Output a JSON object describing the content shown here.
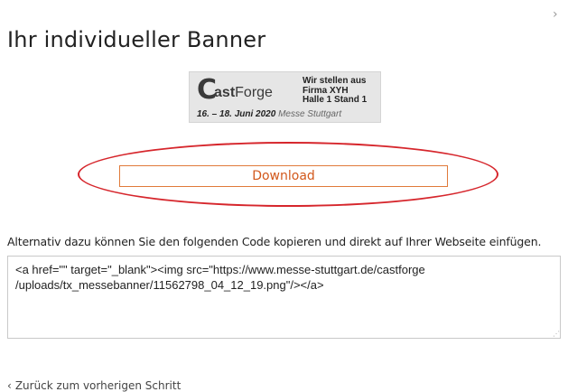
{
  "dialog": {
    "close_glyph": "›",
    "title": "Ihr individueller Banner"
  },
  "banner": {
    "logo_initial": "C",
    "logo_rest_bold": "ast",
    "logo_rest": "Forge",
    "info_line1": "Wir stellen aus",
    "info_line2": "Firma XYH",
    "info_line3": "Halle 1 Stand 1",
    "dates": "16. – 18. Juni 2020",
    "venue": "Messe Stuttgart"
  },
  "download": {
    "label": "Download"
  },
  "code": {
    "intro": "Alternativ dazu können Sie den folgenden Code kopieren und direkt auf Ihrer Webseite einfügen.",
    "line1": "<a href=\"\" target=\"_blank\"><img src=\"https://www.messe-stuttgart.de/castforge",
    "line2": "/uploads/tx_messebanner/11562798_04_12_19.png\"/></a>"
  },
  "nav": {
    "back_chevron": "‹",
    "back_label": "Zurück zum vorherigen Schritt"
  },
  "colors": {
    "accent": "#d2581c",
    "highlight": "#d6262c"
  }
}
